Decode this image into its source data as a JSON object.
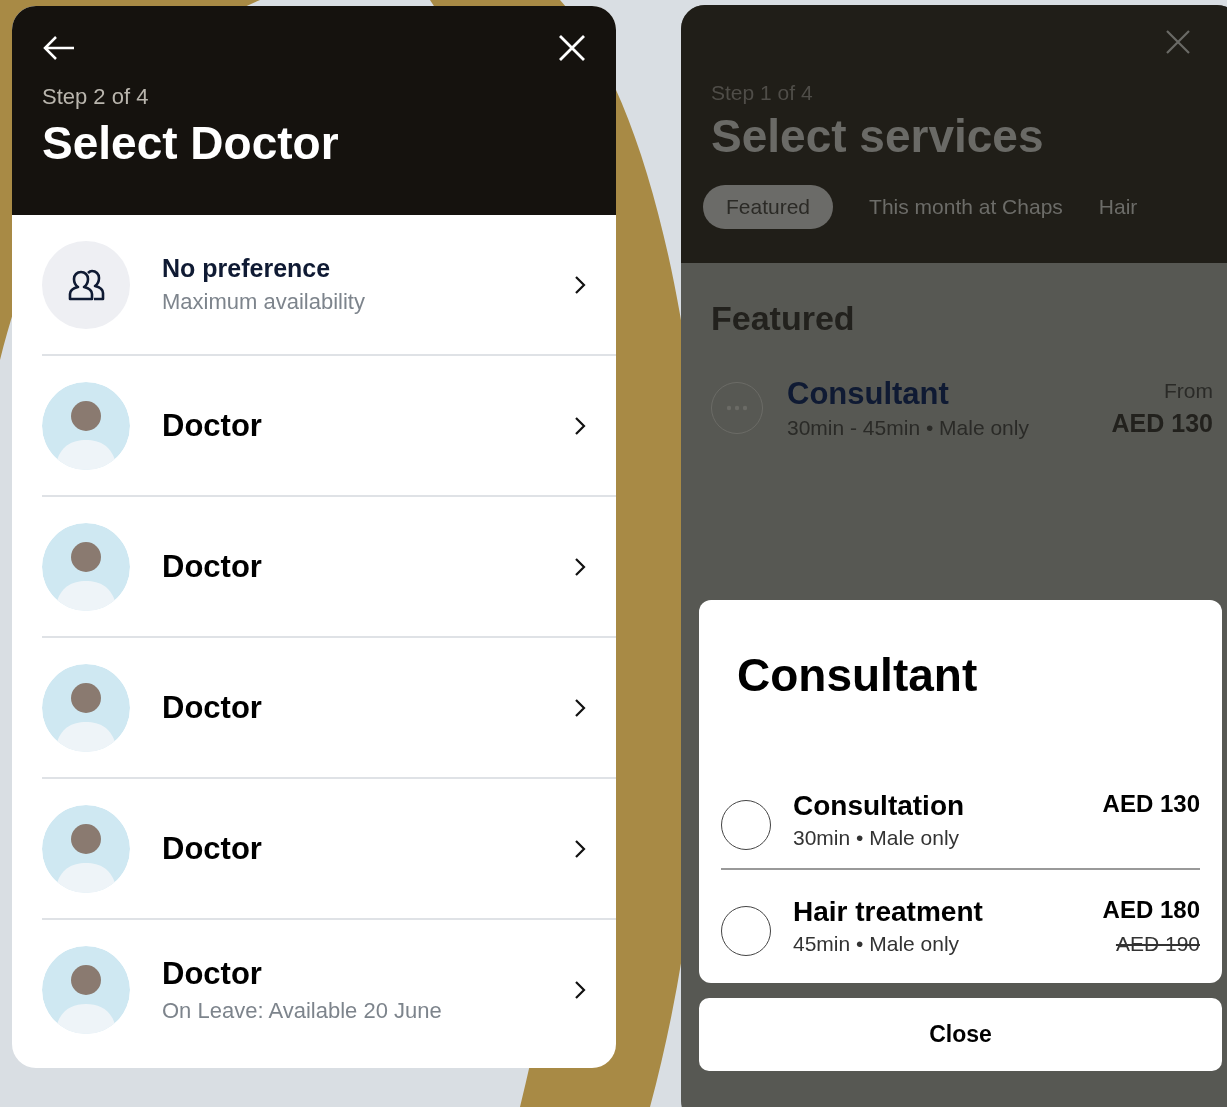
{
  "doctor_panel": {
    "step": "Step 2 of 4",
    "title": "Select Doctor",
    "rows": [
      {
        "kind": "any",
        "name": "No preference",
        "subtitle": "Maximum availability"
      },
      {
        "kind": "doctor",
        "name": "Doctor"
      },
      {
        "kind": "doctor",
        "name": "Doctor"
      },
      {
        "kind": "doctor",
        "name": "Doctor"
      },
      {
        "kind": "doctor",
        "name": "Doctor"
      },
      {
        "kind": "doctor",
        "name": "Doctor",
        "subtitle": "On Leave: Available 20 June"
      }
    ]
  },
  "services_panel": {
    "step": "Step 1 of 4",
    "title": "Select services",
    "tabs": [
      {
        "label": "Featured",
        "selected": true
      },
      {
        "label": "This month at Chaps",
        "selected": false
      },
      {
        "label": "Hair",
        "selected": false
      }
    ],
    "section": "Featured",
    "service": {
      "name": "Consultant",
      "meta": "30min - 45min • Male only",
      "from": "From",
      "price": "AED 130"
    },
    "modal": {
      "title": "Consultant",
      "options": [
        {
          "name": "Consultation",
          "meta": "30min • Male only",
          "price": "AED 130",
          "selected": false
        },
        {
          "name": "Hair treatment",
          "meta": "45min • Male only",
          "price": "AED 180",
          "old_price": "AED 190",
          "selected": false
        }
      ],
      "close": "Close"
    }
  }
}
